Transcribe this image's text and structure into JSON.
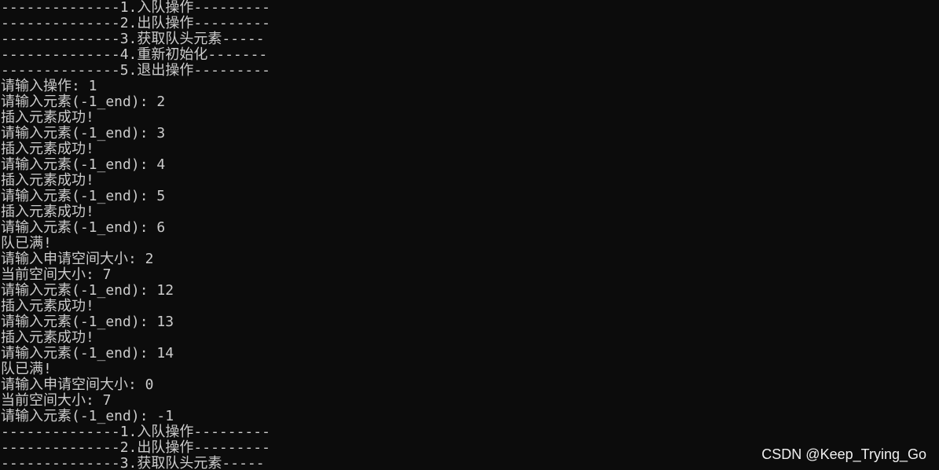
{
  "console": {
    "lines": [
      "--------------1.入队操作---------",
      "--------------2.出队操作---------",
      "--------------3.获取队头元素-----",
      "--------------4.重新初始化-------",
      "--------------5.退出操作---------",
      "请输入操作: 1",
      "请输入元素(-1_end): 2",
      "插入元素成功!",
      "请输入元素(-1_end): 3",
      "插入元素成功!",
      "请输入元素(-1_end): 4",
      "插入元素成功!",
      "请输入元素(-1_end): 5",
      "插入元素成功!",
      "请输入元素(-1_end): 6",
      "队已满!",
      "请输入申请空间大小: 2",
      "当前空间大小: 7",
      "请输入元素(-1_end): 12",
      "插入元素成功!",
      "请输入元素(-1_end): 13",
      "插入元素成功!",
      "请输入元素(-1_end): 14",
      "队已满!",
      "请输入申请空间大小: 0",
      "当前空间大小: 7",
      "请输入元素(-1_end): -1",
      "--------------1.入队操作---------",
      "--------------2.出队操作---------",
      "--------------3.获取队头元素-----"
    ]
  },
  "watermark": {
    "text": "CSDN @Keep_Trying_Go"
  },
  "colors": {
    "background": "#0c0c0c",
    "foreground": "#cccccc"
  }
}
